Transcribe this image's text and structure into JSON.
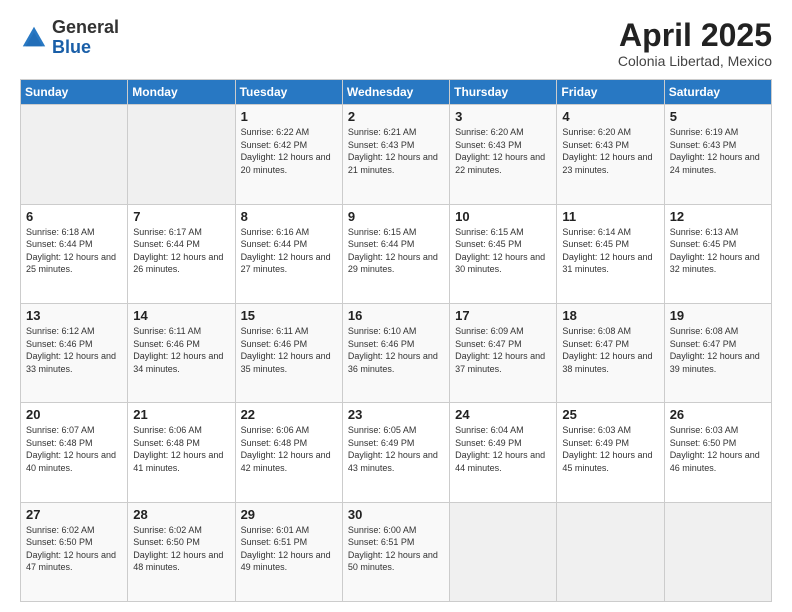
{
  "logo": {
    "general": "General",
    "blue": "Blue"
  },
  "title": "April 2025",
  "subtitle": "Colonia Libertad, Mexico",
  "days_of_week": [
    "Sunday",
    "Monday",
    "Tuesday",
    "Wednesday",
    "Thursday",
    "Friday",
    "Saturday"
  ],
  "weeks": [
    [
      {
        "day": "",
        "info": ""
      },
      {
        "day": "",
        "info": ""
      },
      {
        "day": "1",
        "info": "Sunrise: 6:22 AM\nSunset: 6:42 PM\nDaylight: 12 hours and 20 minutes."
      },
      {
        "day": "2",
        "info": "Sunrise: 6:21 AM\nSunset: 6:43 PM\nDaylight: 12 hours and 21 minutes."
      },
      {
        "day": "3",
        "info": "Sunrise: 6:20 AM\nSunset: 6:43 PM\nDaylight: 12 hours and 22 minutes."
      },
      {
        "day": "4",
        "info": "Sunrise: 6:20 AM\nSunset: 6:43 PM\nDaylight: 12 hours and 23 minutes."
      },
      {
        "day": "5",
        "info": "Sunrise: 6:19 AM\nSunset: 6:43 PM\nDaylight: 12 hours and 24 minutes."
      }
    ],
    [
      {
        "day": "6",
        "info": "Sunrise: 6:18 AM\nSunset: 6:44 PM\nDaylight: 12 hours and 25 minutes."
      },
      {
        "day": "7",
        "info": "Sunrise: 6:17 AM\nSunset: 6:44 PM\nDaylight: 12 hours and 26 minutes."
      },
      {
        "day": "8",
        "info": "Sunrise: 6:16 AM\nSunset: 6:44 PM\nDaylight: 12 hours and 27 minutes."
      },
      {
        "day": "9",
        "info": "Sunrise: 6:15 AM\nSunset: 6:44 PM\nDaylight: 12 hours and 29 minutes."
      },
      {
        "day": "10",
        "info": "Sunrise: 6:15 AM\nSunset: 6:45 PM\nDaylight: 12 hours and 30 minutes."
      },
      {
        "day": "11",
        "info": "Sunrise: 6:14 AM\nSunset: 6:45 PM\nDaylight: 12 hours and 31 minutes."
      },
      {
        "day": "12",
        "info": "Sunrise: 6:13 AM\nSunset: 6:45 PM\nDaylight: 12 hours and 32 minutes."
      }
    ],
    [
      {
        "day": "13",
        "info": "Sunrise: 6:12 AM\nSunset: 6:46 PM\nDaylight: 12 hours and 33 minutes."
      },
      {
        "day": "14",
        "info": "Sunrise: 6:11 AM\nSunset: 6:46 PM\nDaylight: 12 hours and 34 minutes."
      },
      {
        "day": "15",
        "info": "Sunrise: 6:11 AM\nSunset: 6:46 PM\nDaylight: 12 hours and 35 minutes."
      },
      {
        "day": "16",
        "info": "Sunrise: 6:10 AM\nSunset: 6:46 PM\nDaylight: 12 hours and 36 minutes."
      },
      {
        "day": "17",
        "info": "Sunrise: 6:09 AM\nSunset: 6:47 PM\nDaylight: 12 hours and 37 minutes."
      },
      {
        "day": "18",
        "info": "Sunrise: 6:08 AM\nSunset: 6:47 PM\nDaylight: 12 hours and 38 minutes."
      },
      {
        "day": "19",
        "info": "Sunrise: 6:08 AM\nSunset: 6:47 PM\nDaylight: 12 hours and 39 minutes."
      }
    ],
    [
      {
        "day": "20",
        "info": "Sunrise: 6:07 AM\nSunset: 6:48 PM\nDaylight: 12 hours and 40 minutes."
      },
      {
        "day": "21",
        "info": "Sunrise: 6:06 AM\nSunset: 6:48 PM\nDaylight: 12 hours and 41 minutes."
      },
      {
        "day": "22",
        "info": "Sunrise: 6:06 AM\nSunset: 6:48 PM\nDaylight: 12 hours and 42 minutes."
      },
      {
        "day": "23",
        "info": "Sunrise: 6:05 AM\nSunset: 6:49 PM\nDaylight: 12 hours and 43 minutes."
      },
      {
        "day": "24",
        "info": "Sunrise: 6:04 AM\nSunset: 6:49 PM\nDaylight: 12 hours and 44 minutes."
      },
      {
        "day": "25",
        "info": "Sunrise: 6:03 AM\nSunset: 6:49 PM\nDaylight: 12 hours and 45 minutes."
      },
      {
        "day": "26",
        "info": "Sunrise: 6:03 AM\nSunset: 6:50 PM\nDaylight: 12 hours and 46 minutes."
      }
    ],
    [
      {
        "day": "27",
        "info": "Sunrise: 6:02 AM\nSunset: 6:50 PM\nDaylight: 12 hours and 47 minutes."
      },
      {
        "day": "28",
        "info": "Sunrise: 6:02 AM\nSunset: 6:50 PM\nDaylight: 12 hours and 48 minutes."
      },
      {
        "day": "29",
        "info": "Sunrise: 6:01 AM\nSunset: 6:51 PM\nDaylight: 12 hours and 49 minutes."
      },
      {
        "day": "30",
        "info": "Sunrise: 6:00 AM\nSunset: 6:51 PM\nDaylight: 12 hours and 50 minutes."
      },
      {
        "day": "",
        "info": ""
      },
      {
        "day": "",
        "info": ""
      },
      {
        "day": "",
        "info": ""
      }
    ]
  ]
}
